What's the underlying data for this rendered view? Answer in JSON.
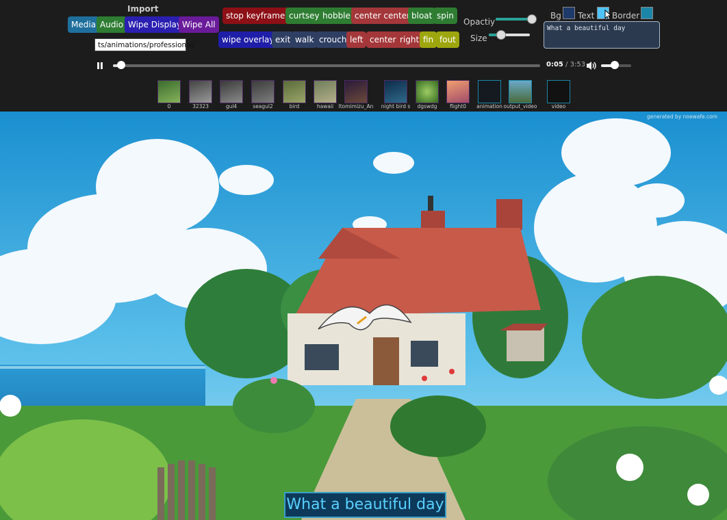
{
  "import_label": "Import",
  "left_buttons": [
    "Media",
    "Audio",
    "Wipe Display",
    "Wipe All"
  ],
  "path_tooltip": "ts/animations/professional/",
  "animation_row1": [
    "stop keyframes",
    "curtsey",
    "hobble",
    "center center",
    "bloat",
    "spin"
  ],
  "animation_row2": [
    "wipe overlay",
    "exit",
    "walk",
    "crouch",
    "left",
    "center",
    "right",
    "fin",
    "fout"
  ],
  "opacity_label": "Opactiy",
  "opacity_value": 0.95,
  "size_label": "Size",
  "size_value": 0.3,
  "colors": {
    "bg_label": "Bg",
    "text_label": "Text",
    "border_label": "Border",
    "bg": "#1e3a6a",
    "text": "#4fc3f7",
    "border": "#1b86a8"
  },
  "text_input_value": "What a beautiful day",
  "player": {
    "current_time": "0:05",
    "separator": " / ",
    "total_time": "3:53",
    "progress": 0.02,
    "volume": 0.45
  },
  "thumbnails": [
    "0",
    "32323",
    "gul4",
    "seagul2",
    "bird",
    "hawaii",
    "ltomimizu_An",
    "night bird s",
    "dgswdg",
    "flight0",
    "animation",
    "output_video",
    "video"
  ],
  "watermark": "generated by noewafe.com",
  "caption": "What a beautiful day"
}
